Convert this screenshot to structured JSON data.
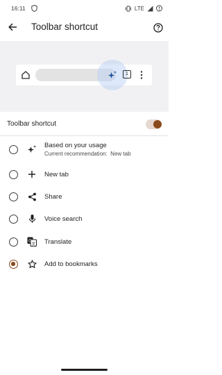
{
  "status_bar": {
    "time": "16:11",
    "network": "LTE"
  },
  "header": {
    "title": "Toolbar shortcut"
  },
  "preview": {
    "tab_count": "1"
  },
  "toggle": {
    "label": "Toolbar shortcut",
    "enabled": true
  },
  "options": [
    {
      "label": "Based on your usage",
      "sublabel_prefix": "Current recommendation:",
      "sublabel_value": "New tab",
      "icon": "sparkle-icon",
      "selected": false
    },
    {
      "label": "New tab",
      "icon": "plus-icon",
      "selected": false
    },
    {
      "label": "Share",
      "icon": "share-icon",
      "selected": false
    },
    {
      "label": "Voice search",
      "icon": "microphone-icon",
      "selected": false
    },
    {
      "label": "Translate",
      "icon": "translate-icon",
      "selected": false
    },
    {
      "label": "Add to bookmarks",
      "icon": "star-icon",
      "selected": true
    }
  ],
  "colors": {
    "accent": "#8a4a1c",
    "preview_bg": "#f1f1f3",
    "highlight": "#b4cdf5"
  }
}
